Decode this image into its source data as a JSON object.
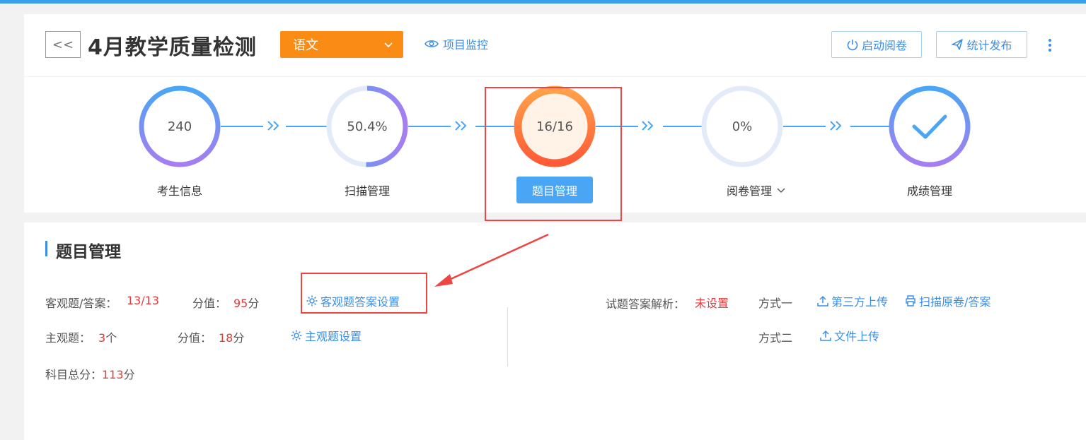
{
  "header": {
    "back_label": "<<",
    "title": "4月教学质量检测",
    "subject": "语文",
    "monitor_label": "项目监控",
    "start_label": "启动阅卷",
    "publish_label": "统计发布"
  },
  "steps": [
    {
      "value": "240",
      "label": "考生信息",
      "progress": 1.0
    },
    {
      "value": "50.4%",
      "label": "扫描管理",
      "progress": 0.504
    },
    {
      "value": "16/16",
      "label": "题目管理",
      "progress": 1.0
    },
    {
      "value": "0%",
      "label": "阅卷管理",
      "progress": 0.0
    },
    {
      "value": "",
      "label": "成绩管理",
      "progress": 1.0
    }
  ],
  "section": {
    "title": "题目管理",
    "objective_label": "客观题/答案：",
    "objective_value": "13/13",
    "objective_score_label": "分值：",
    "objective_score": "95",
    "objective_score_unit": "分",
    "objective_setting": "客观题答案设置",
    "subjective_label": "主观题：",
    "subjective_value": "3",
    "subjective_unit": "个",
    "subjective_score_label": "分值：",
    "subjective_score": "18",
    "subjective_score_unit": "分",
    "subjective_setting": "主观题设置",
    "total_label": "科目总分：",
    "total_value": "113",
    "total_unit": "分",
    "analysis_label": "试题答案解析：",
    "analysis_status": "未设置",
    "method1_label": "方式一",
    "method1_link1": "第三方上传",
    "method1_link2": "扫描原卷/答案",
    "method2_label": "方式二",
    "method2_link": "文件上传"
  },
  "colors": {
    "accent": "#3a8ee6",
    "orange": "#fa8c16",
    "red": "#e03c3c",
    "highlight": "#e44"
  }
}
